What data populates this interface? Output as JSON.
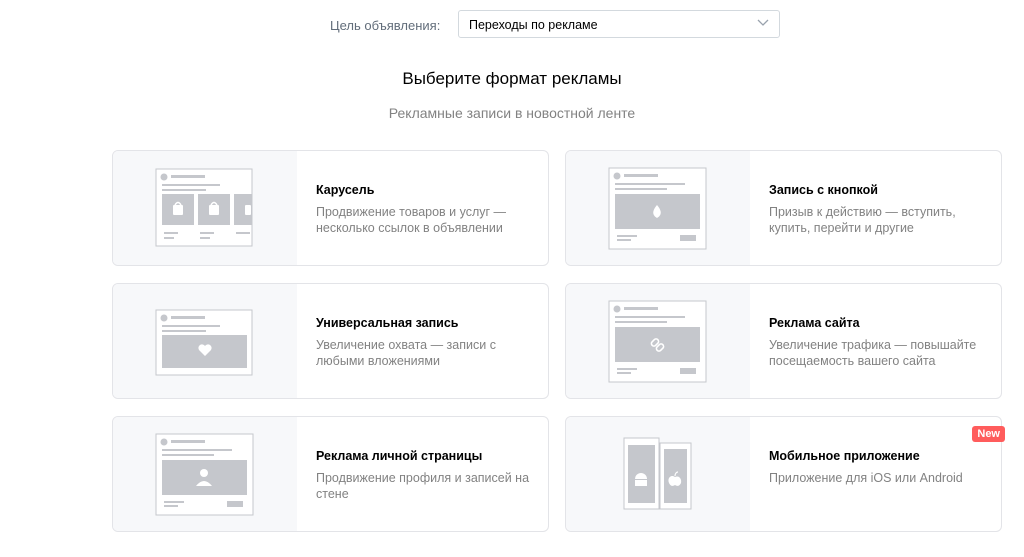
{
  "goal": {
    "label": "Цель объявления:",
    "value": "Переходы по рекламе"
  },
  "heading": "Выберите формат рекламы",
  "subheading": "Рекламные записи в новостной ленте",
  "cards": [
    {
      "title": "Карусель",
      "description": "Продвижение товаров и услуг — несколько ссылок в объявлении",
      "icon": "carousel-icon"
    },
    {
      "title": "Запись с кнопкой",
      "description": "Призыв к действию — вступить, купить, перейти и другие",
      "icon": "fire-icon"
    },
    {
      "title": "Универсальная запись",
      "description": "Увеличение охвата — записи с любыми вложениями",
      "icon": "heart-icon"
    },
    {
      "title": "Реклама сайта",
      "description": "Увеличение трафика — повышайте посещаемость вашего сайта",
      "icon": "link-icon"
    },
    {
      "title": "Реклама личной страницы",
      "description": "Продвижение профиля и записей на стене",
      "icon": "user-icon"
    },
    {
      "title": "Мобильное приложение",
      "description": "Приложение для iOS или Android",
      "icon": "android-apple-icon",
      "badge": "New"
    }
  ],
  "colors": {
    "badge": "#ff5c5c",
    "placeholder": "#c5c7cc",
    "text_secondary": "#828282"
  }
}
